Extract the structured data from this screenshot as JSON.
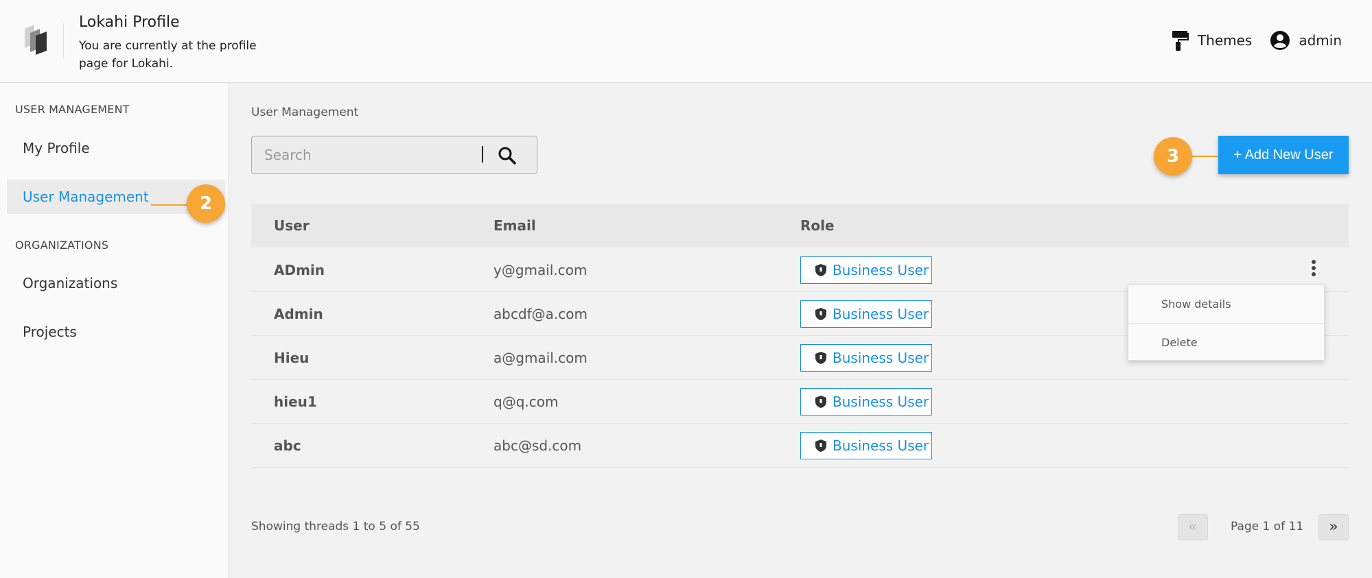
{
  "header": {
    "title": "Lokahi Profile",
    "subtitle": "You are currently at the profile page for Lokahi.",
    "themes_label": "Themes",
    "user_label": "admin"
  },
  "sidebar": {
    "sections": [
      {
        "title": "USER MANAGEMENT",
        "items": [
          {
            "label": "My Profile"
          },
          {
            "label": "User Management",
            "active": true
          }
        ]
      },
      {
        "title": "ORGANIZATIONS",
        "items": [
          {
            "label": "Organizations"
          },
          {
            "label": "Projects"
          }
        ]
      }
    ]
  },
  "callouts": {
    "sidebar": "2",
    "add_button": "3"
  },
  "main": {
    "breadcrumb": "User Management",
    "search_placeholder": "Search",
    "add_button_label": "+ Add New User"
  },
  "table": {
    "columns": [
      "User",
      "Email",
      "Role"
    ],
    "rows": [
      {
        "user": "ADmin",
        "email": "y@gmail.com",
        "role": "Business User"
      },
      {
        "user": "Admin",
        "email": "abcdf@a.com",
        "role": "Business User"
      },
      {
        "user": "Hieu",
        "email": "a@gmail.com",
        "role": "Business User"
      },
      {
        "user": "hieu1",
        "email": "q@q.com",
        "role": "Business User"
      },
      {
        "user": "abc",
        "email": "abc@sd.com",
        "role": "Business User"
      }
    ]
  },
  "row_menu": {
    "items": [
      "Show details",
      "Delete"
    ]
  },
  "footer": {
    "showing_text": "Showing threads 1 to 5 of 55",
    "page_text": "Page 1 of 11",
    "prev_label": "«",
    "next_label": "»"
  },
  "colors": {
    "accent": "#1a9bf2",
    "callout": "#f7a535"
  }
}
